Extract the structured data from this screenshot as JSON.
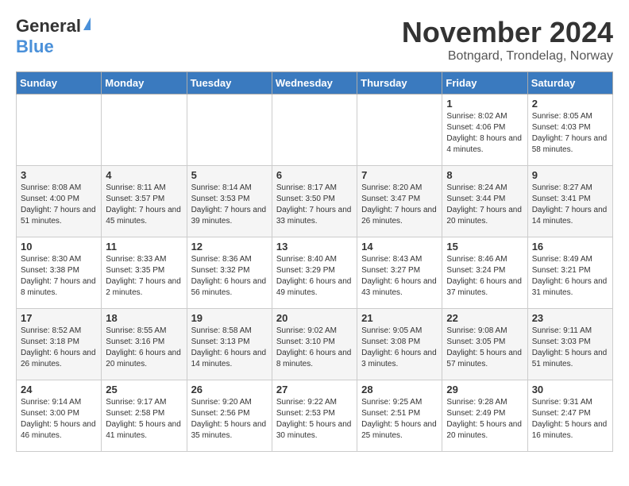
{
  "header": {
    "logo_general": "General",
    "logo_blue": "Blue",
    "month_title": "November 2024",
    "location": "Botngard, Trondelag, Norway"
  },
  "weekdays": [
    "Sunday",
    "Monday",
    "Tuesday",
    "Wednesday",
    "Thursday",
    "Friday",
    "Saturday"
  ],
  "weeks": [
    [
      {
        "day": "",
        "info": ""
      },
      {
        "day": "",
        "info": ""
      },
      {
        "day": "",
        "info": ""
      },
      {
        "day": "",
        "info": ""
      },
      {
        "day": "",
        "info": ""
      },
      {
        "day": "1",
        "info": "Sunrise: 8:02 AM\nSunset: 4:06 PM\nDaylight: 8 hours and 4 minutes."
      },
      {
        "day": "2",
        "info": "Sunrise: 8:05 AM\nSunset: 4:03 PM\nDaylight: 7 hours and 58 minutes."
      }
    ],
    [
      {
        "day": "3",
        "info": "Sunrise: 8:08 AM\nSunset: 4:00 PM\nDaylight: 7 hours and 51 minutes."
      },
      {
        "day": "4",
        "info": "Sunrise: 8:11 AM\nSunset: 3:57 PM\nDaylight: 7 hours and 45 minutes."
      },
      {
        "day": "5",
        "info": "Sunrise: 8:14 AM\nSunset: 3:53 PM\nDaylight: 7 hours and 39 minutes."
      },
      {
        "day": "6",
        "info": "Sunrise: 8:17 AM\nSunset: 3:50 PM\nDaylight: 7 hours and 33 minutes."
      },
      {
        "day": "7",
        "info": "Sunrise: 8:20 AM\nSunset: 3:47 PM\nDaylight: 7 hours and 26 minutes."
      },
      {
        "day": "8",
        "info": "Sunrise: 8:24 AM\nSunset: 3:44 PM\nDaylight: 7 hours and 20 minutes."
      },
      {
        "day": "9",
        "info": "Sunrise: 8:27 AM\nSunset: 3:41 PM\nDaylight: 7 hours and 14 minutes."
      }
    ],
    [
      {
        "day": "10",
        "info": "Sunrise: 8:30 AM\nSunset: 3:38 PM\nDaylight: 7 hours and 8 minutes."
      },
      {
        "day": "11",
        "info": "Sunrise: 8:33 AM\nSunset: 3:35 PM\nDaylight: 7 hours and 2 minutes."
      },
      {
        "day": "12",
        "info": "Sunrise: 8:36 AM\nSunset: 3:32 PM\nDaylight: 6 hours and 56 minutes."
      },
      {
        "day": "13",
        "info": "Sunrise: 8:40 AM\nSunset: 3:29 PM\nDaylight: 6 hours and 49 minutes."
      },
      {
        "day": "14",
        "info": "Sunrise: 8:43 AM\nSunset: 3:27 PM\nDaylight: 6 hours and 43 minutes."
      },
      {
        "day": "15",
        "info": "Sunrise: 8:46 AM\nSunset: 3:24 PM\nDaylight: 6 hours and 37 minutes."
      },
      {
        "day": "16",
        "info": "Sunrise: 8:49 AM\nSunset: 3:21 PM\nDaylight: 6 hours and 31 minutes."
      }
    ],
    [
      {
        "day": "17",
        "info": "Sunrise: 8:52 AM\nSunset: 3:18 PM\nDaylight: 6 hours and 26 minutes."
      },
      {
        "day": "18",
        "info": "Sunrise: 8:55 AM\nSunset: 3:16 PM\nDaylight: 6 hours and 20 minutes."
      },
      {
        "day": "19",
        "info": "Sunrise: 8:58 AM\nSunset: 3:13 PM\nDaylight: 6 hours and 14 minutes."
      },
      {
        "day": "20",
        "info": "Sunrise: 9:02 AM\nSunset: 3:10 PM\nDaylight: 6 hours and 8 minutes."
      },
      {
        "day": "21",
        "info": "Sunrise: 9:05 AM\nSunset: 3:08 PM\nDaylight: 6 hours and 3 minutes."
      },
      {
        "day": "22",
        "info": "Sunrise: 9:08 AM\nSunset: 3:05 PM\nDaylight: 5 hours and 57 minutes."
      },
      {
        "day": "23",
        "info": "Sunrise: 9:11 AM\nSunset: 3:03 PM\nDaylight: 5 hours and 51 minutes."
      }
    ],
    [
      {
        "day": "24",
        "info": "Sunrise: 9:14 AM\nSunset: 3:00 PM\nDaylight: 5 hours and 46 minutes."
      },
      {
        "day": "25",
        "info": "Sunrise: 9:17 AM\nSunset: 2:58 PM\nDaylight: 5 hours and 41 minutes."
      },
      {
        "day": "26",
        "info": "Sunrise: 9:20 AM\nSunset: 2:56 PM\nDaylight: 5 hours and 35 minutes."
      },
      {
        "day": "27",
        "info": "Sunrise: 9:22 AM\nSunset: 2:53 PM\nDaylight: 5 hours and 30 minutes."
      },
      {
        "day": "28",
        "info": "Sunrise: 9:25 AM\nSunset: 2:51 PM\nDaylight: 5 hours and 25 minutes."
      },
      {
        "day": "29",
        "info": "Sunrise: 9:28 AM\nSunset: 2:49 PM\nDaylight: 5 hours and 20 minutes."
      },
      {
        "day": "30",
        "info": "Sunrise: 9:31 AM\nSunset: 2:47 PM\nDaylight: 5 hours and 16 minutes."
      }
    ]
  ]
}
